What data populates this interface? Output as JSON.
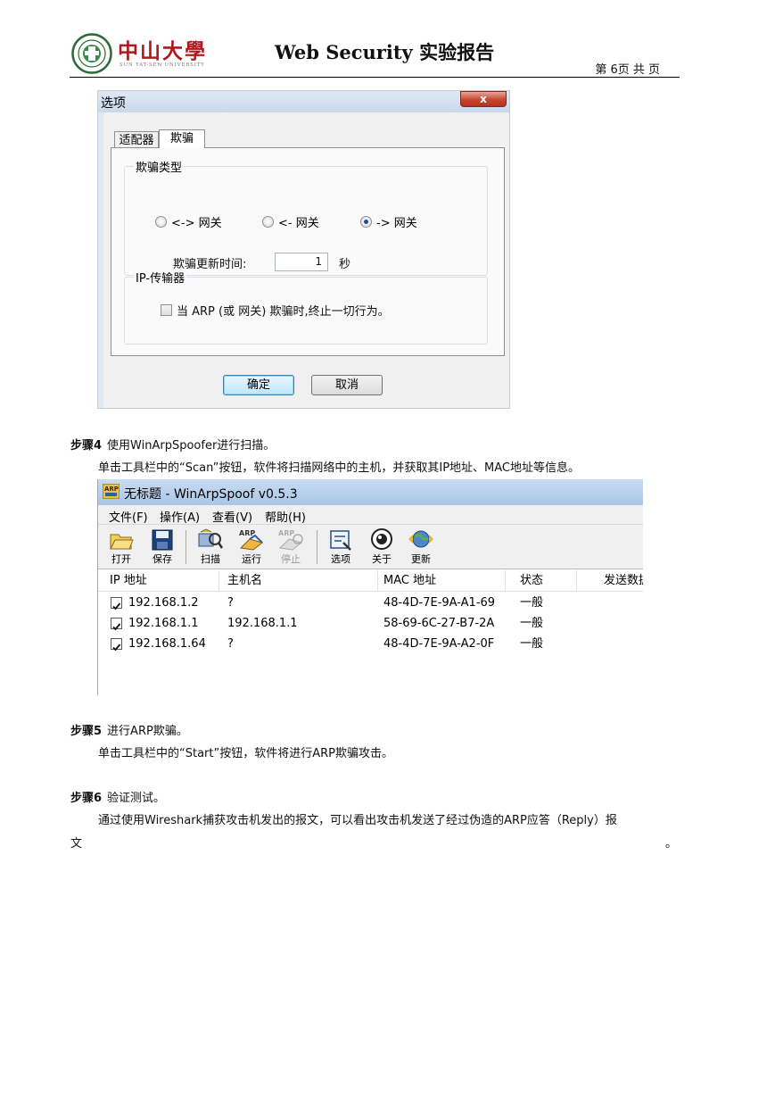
{
  "header": {
    "logo_text": "中山大學",
    "logo_sub": "SUN YAT-SEN UNIVERSITY",
    "doc_title": "Web Security 实验报告",
    "page_number": "第 6页 共   页"
  },
  "options_dialog": {
    "title": "选项",
    "close_label": "x",
    "tabs": [
      {
        "label": "适配器"
      },
      {
        "label": "欺骗"
      }
    ],
    "spoof_group_label": "欺骗类型",
    "radio_options": [
      {
        "label": "<-> 网关",
        "selected": false
      },
      {
        "label": "<- 网关",
        "selected": false
      },
      {
        "label": "-> 网关",
        "selected": true
      }
    ],
    "update_time_label": "欺骗更新时间:",
    "update_time_value": "1",
    "update_time_unit": "秒",
    "ip_group_label": "IP-传输器",
    "stop_checkbox_label": "当 ARP (或 网关) 欺骗时,终止一切行为。",
    "ok_label": "确定",
    "cancel_label": "取消"
  },
  "step4": {
    "label": "步骤4",
    "title": "使用WinArpSpoofer进行扫描。",
    "desc": "单击工具栏中的“Scan”按钮，软件将扫描网络中的主机，并获取其IP地址、MAC地址等信息。"
  },
  "app_window": {
    "title": "无标题 - WinArpSpoof v0.5.3",
    "menu": [
      "文件(F)",
      "操作(A)",
      "查看(V)",
      "帮助(H)"
    ],
    "toolbar": [
      "打开",
      "保存",
      "扫描",
      "运行",
      "停止",
      "选项",
      "关于",
      "更新"
    ],
    "columns": [
      "IP 地址",
      "主机名",
      "MAC 地址",
      "状态",
      "发送数据"
    ],
    "rows": [
      {
        "ip": "192.168.1.2",
        "host": "?",
        "mac": "48-4D-7E-9A-A1-69",
        "status": "一般"
      },
      {
        "ip": "192.168.1.1",
        "host": "192.168.1.1",
        "mac": "58-69-6C-27-B7-2A",
        "status": "一般"
      },
      {
        "ip": "192.168.1.64",
        "host": "?",
        "mac": "48-4D-7E-9A-A2-0F",
        "status": "一般"
      }
    ]
  },
  "step5": {
    "label": "步骤5",
    "title": "进行ARP欺骗。",
    "desc": "单击工具栏中的“Start”按钮，软件将进行ARP欺骗攻击。"
  },
  "step6": {
    "label": "步骤6",
    "title": "验证测试。",
    "desc_line1": "通过使用Wireshark捕获攻击机发出的报文，可以看出攻击机发送了经过伪造的ARP应答（Reply）报",
    "desc_line2": "文",
    "desc_end": "。"
  }
}
